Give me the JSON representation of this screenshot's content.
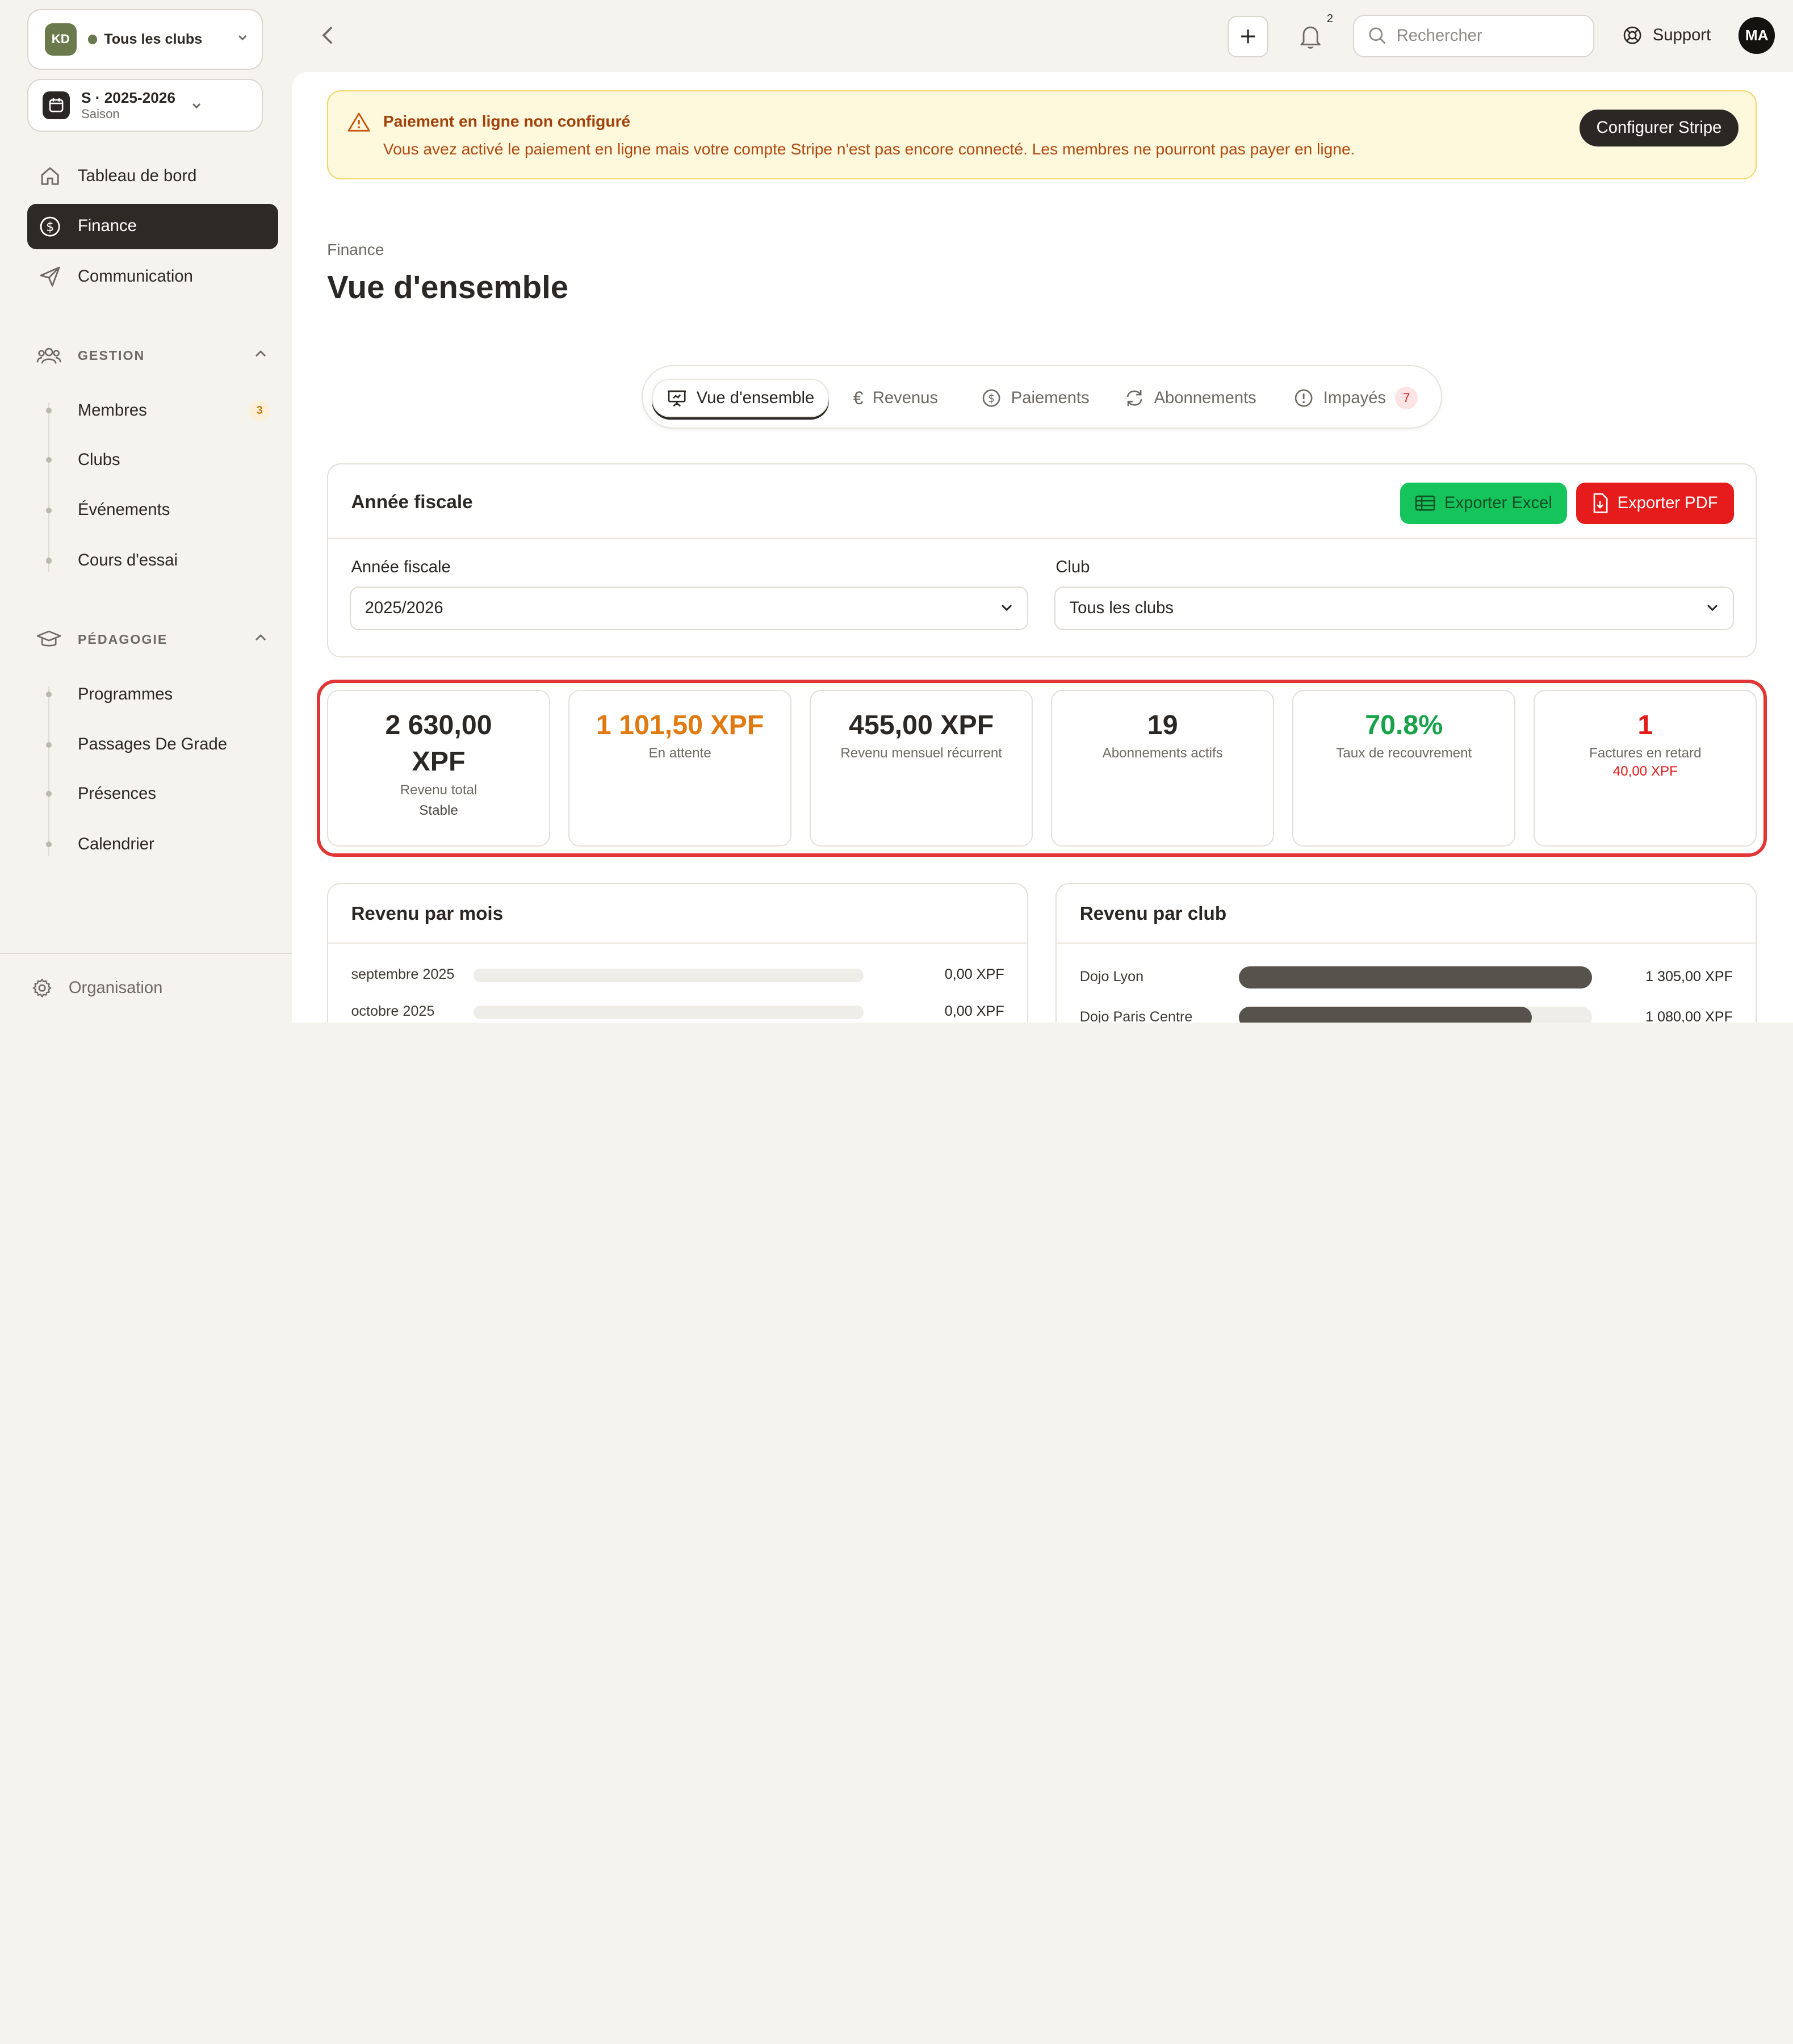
{
  "sidebar": {
    "club_switch": {
      "avatar": "KD",
      "label": "Tous les clubs"
    },
    "season": {
      "title": "S · 2025-2026",
      "subtitle": "Saison"
    },
    "nav": [
      {
        "label": "Tableau de bord",
        "icon": "home-icon"
      },
      {
        "label": "Finance",
        "icon": "dollar-circle-icon",
        "active": true
      },
      {
        "label": "Communication",
        "icon": "send-icon"
      }
    ],
    "gestion": {
      "title": "GESTION",
      "items": [
        {
          "label": "Membres",
          "badge": "3"
        },
        {
          "label": "Clubs"
        },
        {
          "label": "Événements"
        },
        {
          "label": "Cours d'essai"
        }
      ]
    },
    "pedagogie": {
      "title": "PÉDAGOGIE",
      "items": [
        {
          "label": "Programmes"
        },
        {
          "label": "Passages De Grade"
        },
        {
          "label": "Présences"
        },
        {
          "label": "Calendrier"
        }
      ]
    },
    "footer": {
      "label": "Organisation"
    }
  },
  "topbar": {
    "notifications": "2",
    "search_placeholder": "Rechercher",
    "support_label": "Support",
    "user_initials": "MA"
  },
  "alert": {
    "title": "Paiement en ligne non configuré",
    "text": "Vous avez activé le paiement en ligne mais votre compte Stripe n'est pas encore connecté. Les membres ne pourront pas payer en ligne.",
    "button": "Configurer Stripe"
  },
  "page": {
    "breadcrumb": "Finance",
    "title": "Vue d'ensemble"
  },
  "tabs": [
    {
      "label": "Vue d'ensemble",
      "icon": "presentation-icon"
    },
    {
      "label": "Revenus",
      "icon": "euro-icon"
    },
    {
      "label": "Paiements",
      "icon": "dollar-circle-icon"
    },
    {
      "label": "Abonnements",
      "icon": "refresh-icon"
    },
    {
      "label": "Impayés",
      "icon": "alert-circle-icon",
      "badge": "7"
    }
  ],
  "filters": {
    "title": "Année fiscale",
    "export_excel": "Exporter Excel",
    "export_pdf": "Exporter PDF",
    "year_label": "Année fiscale",
    "year_value": "2025/2026",
    "club_label": "Club",
    "club_value": "Tous les clubs"
  },
  "kpis": [
    {
      "value": "2 630,00 XPF",
      "label": "Revenu total",
      "sub": "Stable",
      "color": "#2a2724"
    },
    {
      "value": "1 101,50 XPF",
      "label": "En attente",
      "color": "#e07a10"
    },
    {
      "value": "455,00 XPF",
      "label": "Revenu mensuel récurrent",
      "color": "#2a2724"
    },
    {
      "value": "19",
      "label": "Abonnements actifs",
      "color": "#2a2724"
    },
    {
      "value": "70.8%",
      "label": "Taux de recouvrement",
      "color": "#17a34a"
    },
    {
      "value": "1",
      "label": "Factures en retard",
      "sub": "40,00 XPF",
      "color": "#e01b1b"
    }
  ],
  "revenue_by_month": {
    "title": "Revenu par mois",
    "rows": [
      {
        "label": "septembre 2025",
        "value": "0,00 XPF",
        "fraction": 0
      },
      {
        "label": "octobre 2025",
        "value": "0,00 XPF",
        "fraction": 0
      }
    ]
  },
  "revenue_by_club": {
    "title": "Revenu par club",
    "rows": [
      {
        "label": "Dojo Lyon",
        "value": "1 305,00 XPF",
        "fraction": 1.0
      },
      {
        "label": "Dojo Paris Centre",
        "value": "1 080,00 XPF",
        "fraction": 0.83
      }
    ]
  }
}
